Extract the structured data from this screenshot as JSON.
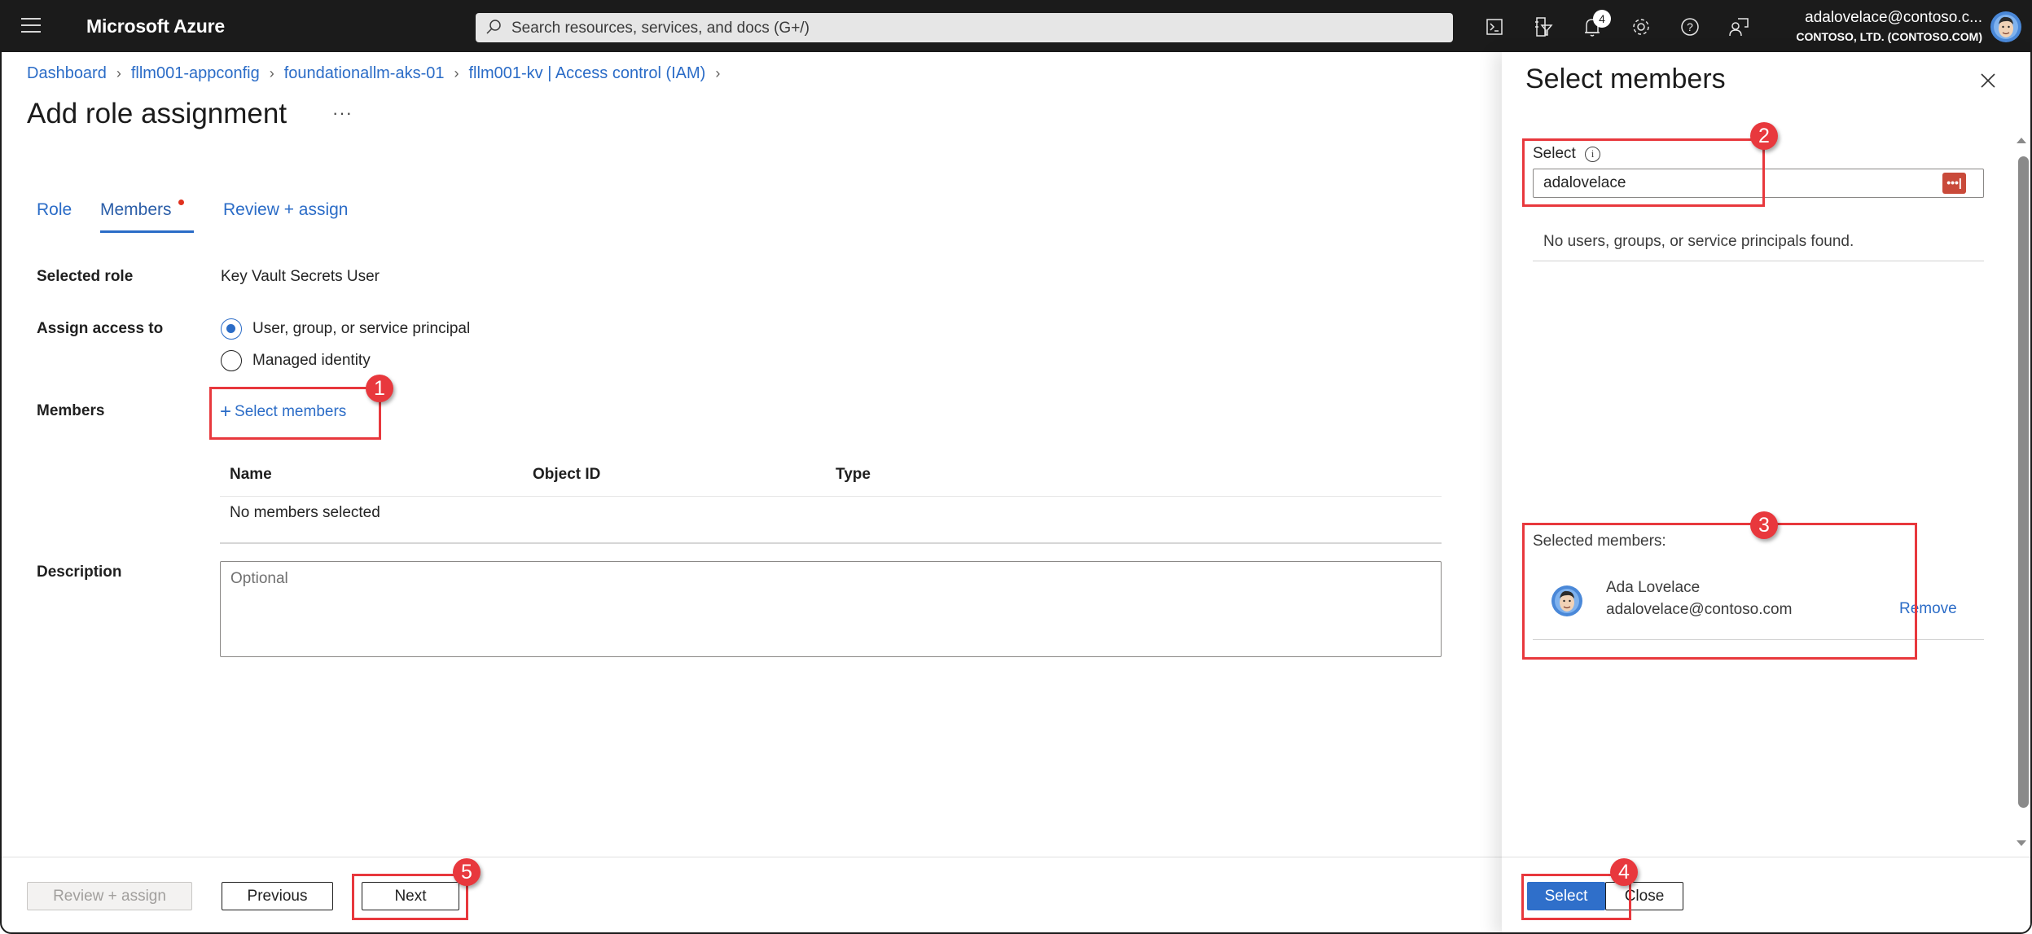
{
  "topbar": {
    "brand": "Microsoft Azure",
    "search_placeholder": "Search resources, services, and docs (G+/)",
    "icons": [
      "cloud-shell-icon",
      "directory-filter-icon",
      "notifications-icon",
      "settings-icon",
      "help-icon",
      "feedback-icon"
    ],
    "notification_count": "4",
    "account_email": "adalovelace@contoso.c...",
    "account_tenant": "CONTOSO, LTD. (CONTOSO.COM)"
  },
  "breadcrumb": [
    "Dashboard",
    "fllm001-appconfig",
    "foundationallm-aks-01",
    "fllm001-kv | Access control (IAM)"
  ],
  "page": {
    "title": "Add role assignment",
    "more": "···"
  },
  "tabs": [
    {
      "label": "Role",
      "active": false
    },
    {
      "label": "Members",
      "active": true
    },
    {
      "label": "Review + assign",
      "active": false
    }
  ],
  "form": {
    "selected_role_label": "Selected role",
    "selected_role_value": "Key Vault Secrets User",
    "assign_access_label": "Assign access to",
    "assign_options": [
      {
        "label": "User, group, or service principal",
        "selected": true
      },
      {
        "label": "Managed identity",
        "selected": false
      }
    ],
    "members_label": "Members",
    "select_members_link": "Select members",
    "members_table": {
      "columns": [
        "Name",
        "Object ID",
        "Type"
      ],
      "empty_text": "No members selected"
    },
    "description_label": "Description",
    "description_placeholder": "Optional",
    "description_value": ""
  },
  "footer": {
    "review_assign": "Review + assign",
    "previous": "Previous",
    "next": "Next"
  },
  "panel": {
    "title": "Select members",
    "select_label": "Select",
    "search_value": "adalovelace",
    "no_results": "No users, groups, or service principals found.",
    "selected_members_label": "Selected members:",
    "selected_members": [
      {
        "name": "Ada Lovelace",
        "email": "adalovelace@contoso.com",
        "remove_label": "Remove"
      }
    ],
    "select_button": "Select",
    "close_button": "Close"
  },
  "annotations": [
    "1",
    "2",
    "3",
    "4",
    "5"
  ],
  "colors": {
    "accent": "#2b6cc7",
    "topbar": "#1b1b1b",
    "primary_button": "#2f6fca",
    "annotation": "#e8383d"
  }
}
